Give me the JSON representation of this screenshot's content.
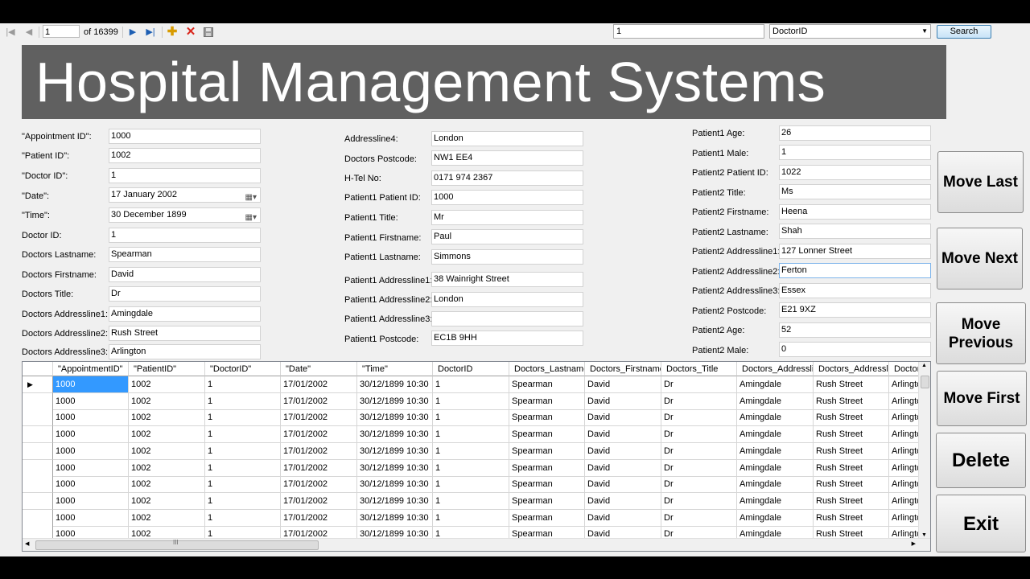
{
  "navigator": {
    "position": "1",
    "count_label": "of 16399",
    "search_value": "1",
    "search_field": "DoctorID",
    "search_button": "Search"
  },
  "title": "Hospital Management Systems",
  "col1": [
    {
      "label": "\"Appointment ID\":",
      "value": "1000"
    },
    {
      "label": "\"Patient ID\":",
      "value": "1002"
    },
    {
      "label": "\"Doctor ID\":",
      "value": "1"
    },
    {
      "label": "\"Date\":",
      "value": "17  January  2002"
    },
    {
      "label": "\"Time\":",
      "value": "30 December 1899"
    },
    {
      "label": "Doctor ID:",
      "value": "1"
    },
    {
      "label": "Doctors Lastname:",
      "value": "Spearman"
    },
    {
      "label": "Doctors Firstname:",
      "value": "David"
    },
    {
      "label": "Doctors Title:",
      "value": "Dr"
    },
    {
      "label": "Doctors Addressline1:",
      "value": "Amingdale"
    },
    {
      "label": "Doctors Addressline2:",
      "value": "Rush Street"
    },
    {
      "label": "Doctors Addressline3:",
      "value": "Arlington"
    }
  ],
  "col2": [
    {
      "label": "Addressline4:",
      "value": "London"
    },
    {
      "label": "Doctors Postcode:",
      "value": "NW1 EE4"
    },
    {
      "label": "H-Tel No:",
      "value": "0171 974 2367"
    },
    {
      "label": "Patient1 Patient ID:",
      "value": "1000"
    },
    {
      "label": "Patient1 Title:",
      "value": "Mr"
    },
    {
      "label": "Patient1 Firstname:",
      "value": "Paul"
    },
    {
      "label": "Patient1 Lastname:",
      "value": "Simmons"
    },
    {
      "label": "Patient1 Addressline1:",
      "value": "38 Wainright Street"
    },
    {
      "label": "Patient1 Addressline2:",
      "value": "London"
    },
    {
      "label": "Patient1 Addressline3:",
      "value": ""
    },
    {
      "label": "Patient1 Postcode:",
      "value": "EC1B 9HH"
    }
  ],
  "col3": [
    {
      "label": "Patient1 Age:",
      "value": "26"
    },
    {
      "label": "Patient1 Male:",
      "value": "1"
    },
    {
      "label": "Patient2 Patient ID:",
      "value": "1022"
    },
    {
      "label": "Patient2 Title:",
      "value": "Ms"
    },
    {
      "label": "Patient2 Firstname:",
      "value": "Heena"
    },
    {
      "label": "Patient2 Lastname:",
      "value": "Shah"
    },
    {
      "label": "Patient2 Addressline1:",
      "value": "127 Lonner Street"
    },
    {
      "label": "Patient2 Addressline2:",
      "value": "Ferton"
    },
    {
      "label": "Patient2 Addressline3:",
      "value": "Essex"
    },
    {
      "label": "Patient2 Postcode:",
      "value": "E21 9XZ"
    },
    {
      "label": "Patient2 Age:",
      "value": "52"
    },
    {
      "label": "Patient2 Male:",
      "value": "0"
    }
  ],
  "buttons": {
    "move_last": "Move Last",
    "move_next": "Move Next",
    "move_previous": "Move Previous",
    "move_first": "Move First",
    "delete": "Delete",
    "exit": "Exit"
  },
  "grid": {
    "columns": [
      "\"AppointmentID\"",
      "\"PatientID\"",
      "\"DoctorID\"",
      "\"Date\"",
      "\"Time\"",
      "DoctorID",
      "Doctors_Lastname",
      "Doctors_Firstname",
      "Doctors_Title",
      "Doctors_Addresslin",
      "Doctors_Addresslin",
      "Doctor"
    ],
    "row": [
      "1000",
      "1002",
      "1",
      "17/01/2002",
      "30/12/1899 10:30",
      "1",
      "Spearman",
      "David",
      "Dr",
      "Amingdale",
      "Rush Street",
      "Arlingto"
    ],
    "row_count": 10,
    "current_row_marker": "▶",
    "scroll_grip": "III"
  },
  "colors": {
    "banner_bg": "#606060",
    "selected_cell": "#3399ff"
  }
}
